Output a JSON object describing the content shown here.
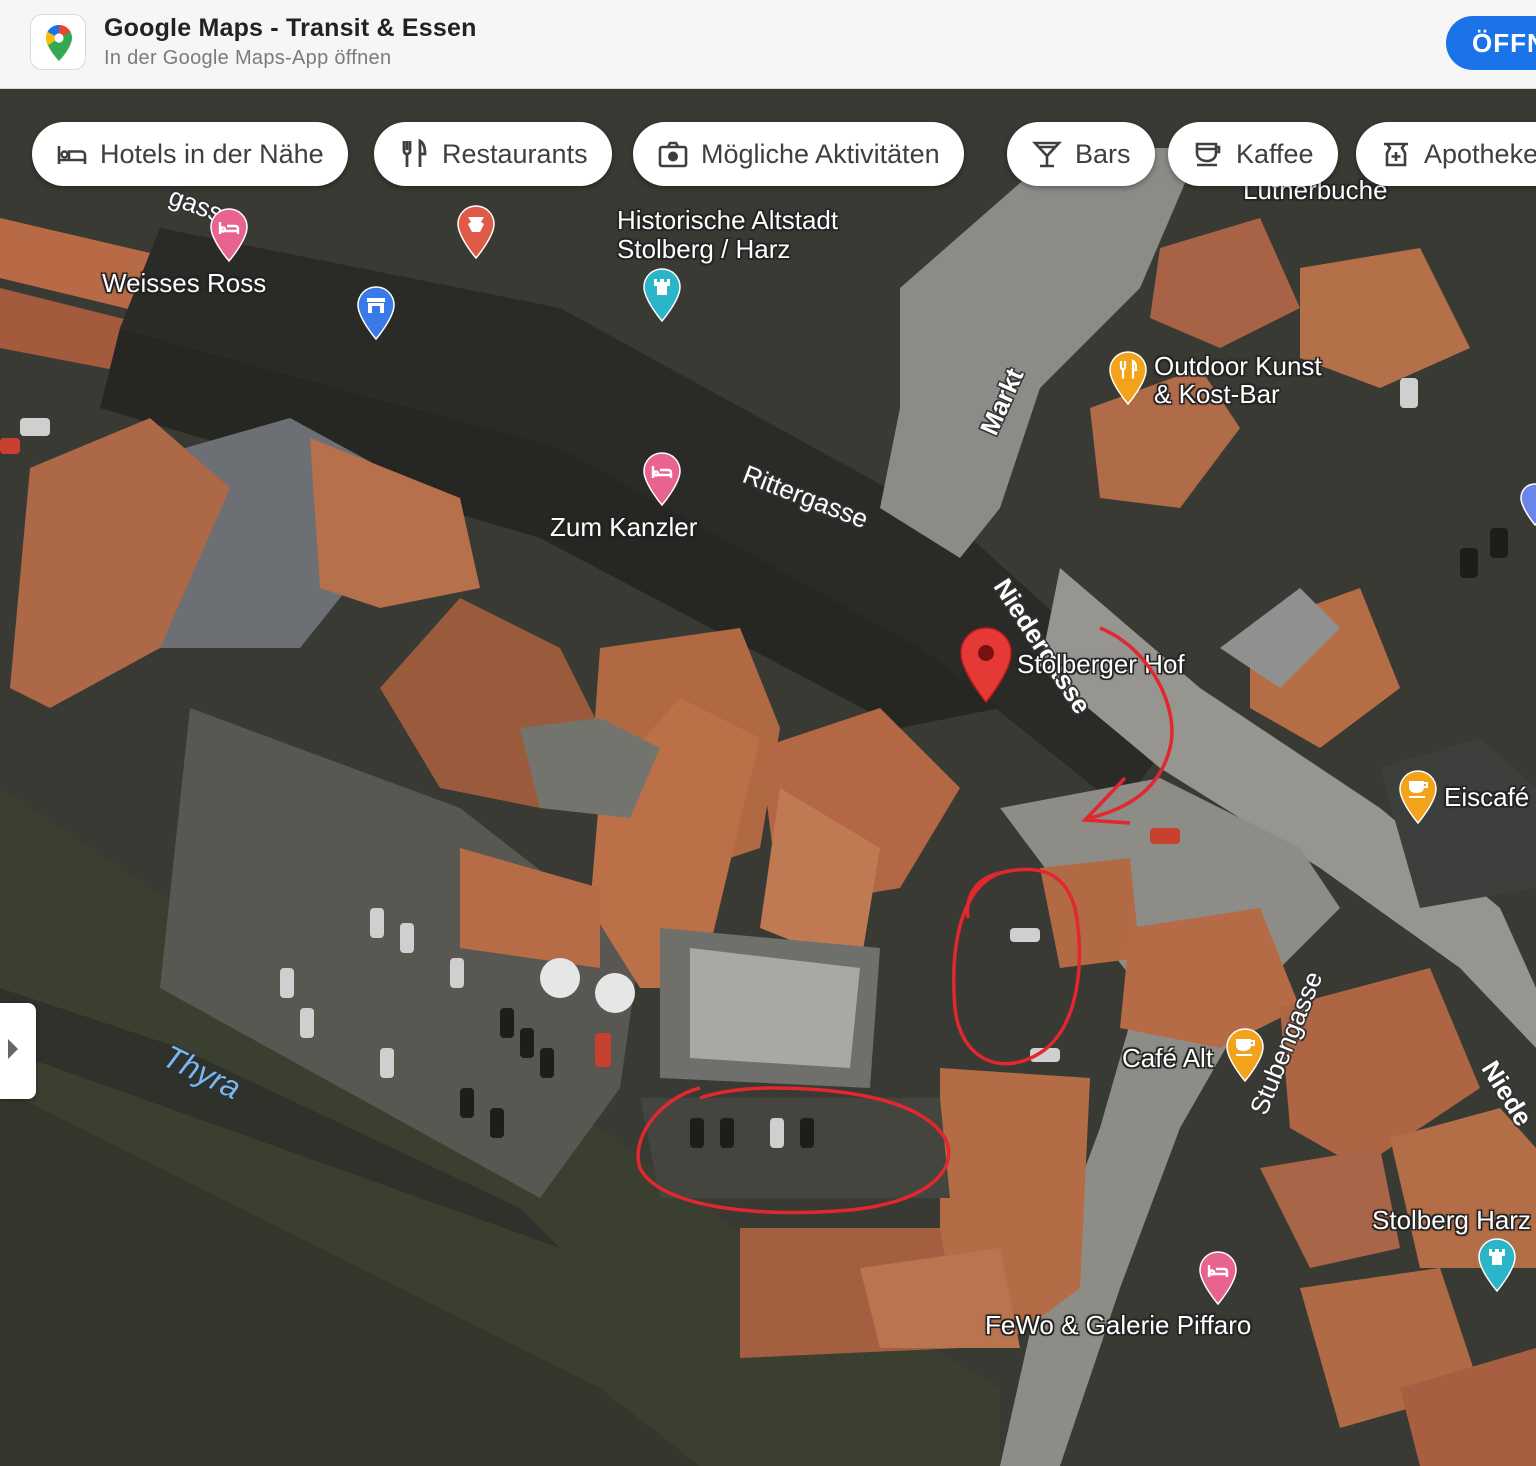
{
  "banner": {
    "title": "Google Maps - Transit & Essen",
    "subtitle": "In der Google Maps-App öffnen",
    "open_button": "ÖFFNEN",
    "icon": "google-maps-app-icon"
  },
  "chips": [
    {
      "label": "Hotels in der Nähe",
      "icon": "bed-icon"
    },
    {
      "label": "Restaurants",
      "icon": "fork-knife-icon"
    },
    {
      "label": "Mögliche Aktivitäten",
      "icon": "camera-icon"
    },
    {
      "label": "Bars",
      "icon": "cocktail-icon"
    },
    {
      "label": "Kaffee",
      "icon": "coffee-cup-icon"
    },
    {
      "label": "Apotheken",
      "icon": "pharmacy-icon"
    }
  ],
  "places": {
    "weisses_ross": "Weisses Ross",
    "historische_altstadt": "Historische Altstadt",
    "historische_altstadt_2": "Stolberg / Harz",
    "outdoor_kunst": "Outdoor Kunst",
    "outdoor_kunst_2": "& Kost-Bar",
    "zum_kanzler": "Zum Kanzler",
    "stolberger_hof": "Stolberger Hof",
    "eiscafe": "Eiscafé",
    "cafe_alt": "Café Alt",
    "stolberg_harz": "Stolberg Harz",
    "fewo": "FeWo & Galerie Piffaro",
    "lutherbuche": "Lutherbuche",
    "gasse_partial": "gasse"
  },
  "streets": {
    "markt": "Markt",
    "rittergasse": "Rittergasse",
    "niedergasse": "Niedergasse",
    "stubengasse": "Stubengasse",
    "niede_partial": "Niede"
  },
  "river": "Thyra",
  "colors": {
    "hotel_pin": "#e8638f",
    "food_pin": "#f2a31b",
    "attraction_pin": "#2bb5c8",
    "store_pin": "#3a79e8",
    "selected_pin": "#e53935",
    "annotation": "#e0282e"
  }
}
